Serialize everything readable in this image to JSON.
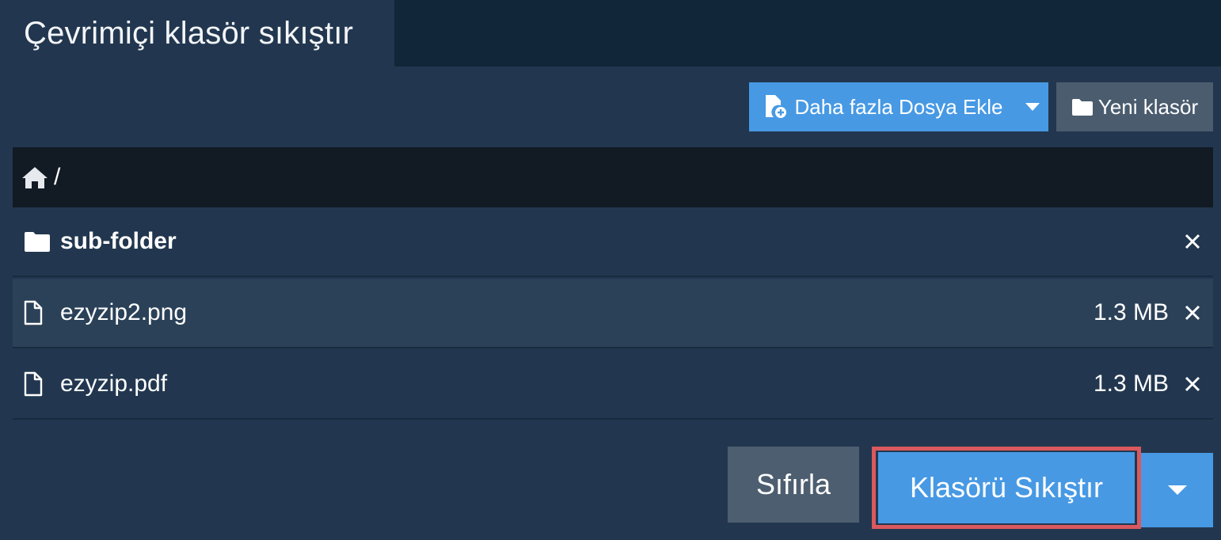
{
  "tab": {
    "title": "Çevrimiçi klasör sıkıştır"
  },
  "toolbar": {
    "add_files_label": "Daha fazla Dosya Ekle",
    "add_files_icon": "file-plus-icon",
    "add_files_menu_icon": "caret-down-icon",
    "new_folder_label": "Yeni klasör",
    "new_folder_icon": "folder-icon"
  },
  "breadcrumb": {
    "home_icon": "home-icon",
    "path": "/"
  },
  "entries": [
    {
      "type": "folder",
      "icon": "folder-icon",
      "name": "sub-folder",
      "size": "",
      "remove_icon": "close-icon"
    },
    {
      "type": "file",
      "icon": "file-icon",
      "name": "ezyzip2.png",
      "size": "1.3 MB",
      "remove_icon": "close-icon"
    },
    {
      "type": "file",
      "icon": "file-icon",
      "name": "ezyzip.pdf",
      "size": "1.3 MB",
      "remove_icon": "close-icon"
    }
  ],
  "actions": {
    "reset_label": "Sıfırla",
    "compress_label": "Klasörü Sıkıştır",
    "compress_menu_icon": "caret-down-icon"
  },
  "colors": {
    "accent": "#4799e4",
    "panel": "#22374f",
    "background": "#12263a",
    "highlight_outline": "#d9595e"
  }
}
